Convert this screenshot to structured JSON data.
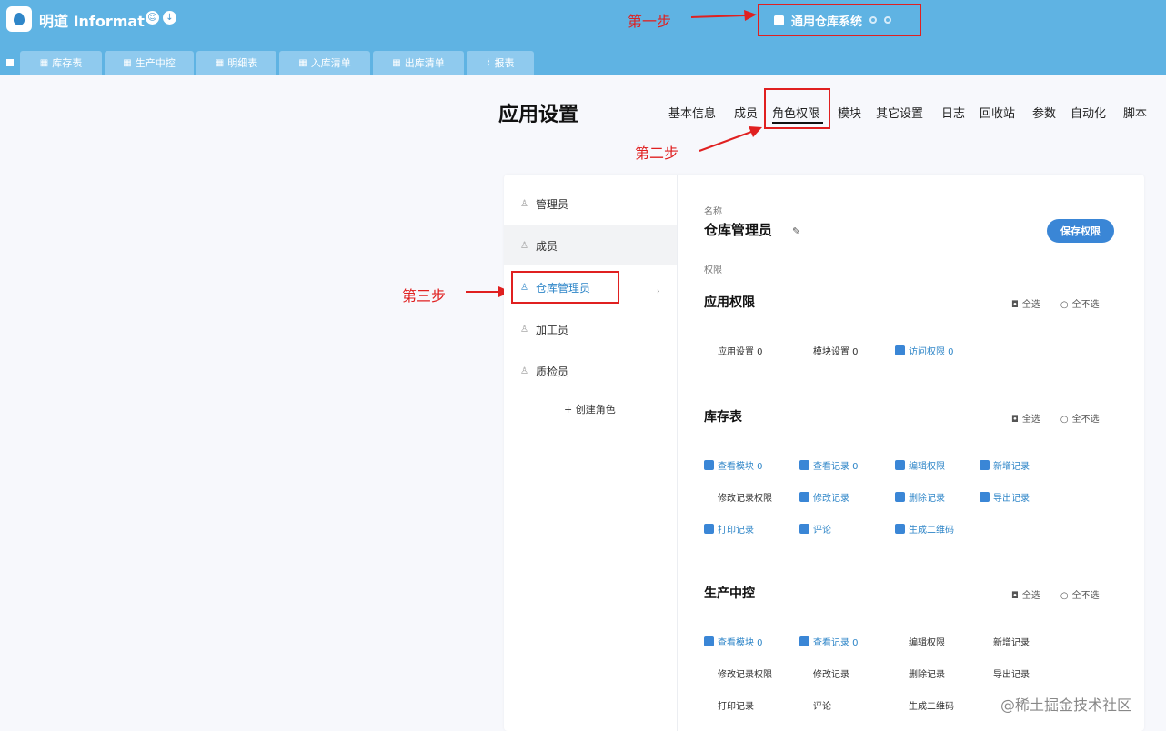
{
  "app": {
    "brand": "明道 Informat",
    "current_app": "通用仓库系统"
  },
  "tabs": [
    {
      "icon": "▦",
      "label": "库存表"
    },
    {
      "icon": "▦",
      "label": "生产中控"
    },
    {
      "icon": "▦",
      "label": "明细表"
    },
    {
      "icon": "▦",
      "label": "入库清单"
    },
    {
      "icon": "▦",
      "label": "出库清单"
    },
    {
      "icon": "⌇",
      "label": "报表"
    }
  ],
  "annotations": {
    "step1": "第一步",
    "step2": "第二步",
    "step3": "第三步"
  },
  "page_title": "应用设置",
  "settings_nav": [
    "基本信息",
    "成员",
    "角色权限",
    "模块",
    "其它设置",
    "日志",
    "回收站",
    "参数",
    "自动化",
    "脚本"
  ],
  "settings_nav_active": "角色权限",
  "roles": [
    {
      "icon": "♙",
      "label": "管理员"
    },
    {
      "icon": "♙",
      "label": "成员"
    },
    {
      "icon": "♙",
      "label": "仓库管理员"
    },
    {
      "icon": "♙",
      "label": "加工员"
    },
    {
      "icon": "♙",
      "label": "质检员"
    }
  ],
  "add_role_label": "+ 创建角色",
  "detail": {
    "name_label": "名称",
    "role_name": "仓库管理员",
    "permissions_label": "权限",
    "save_label": "保存权限",
    "select_all": "全选",
    "select_none": "全不选",
    "sections": [
      {
        "title": "应用权限",
        "rows": [
          [
            {
              "label": "应用设置 0",
              "checked": false
            },
            {
              "label": "模块设置 0",
              "checked": false
            },
            {
              "label": "访问权限 0",
              "checked": true
            }
          ]
        ]
      },
      {
        "title": "库存表",
        "rows": [
          [
            {
              "label": "查看模块 0",
              "checked": true
            },
            {
              "label": "查看记录 0",
              "checked": true
            },
            {
              "label": "编辑权限",
              "checked": true
            },
            {
              "label": "新增记录",
              "checked": true
            }
          ],
          [
            {
              "label": "修改记录权限",
              "checked": false
            },
            {
              "label": "修改记录",
              "checked": true
            },
            {
              "label": "删除记录",
              "checked": true
            },
            {
              "label": "导出记录",
              "checked": true
            }
          ],
          [
            {
              "label": "打印记录",
              "checked": true
            },
            {
              "label": "评论",
              "checked": true
            },
            {
              "label": "生成二维码",
              "checked": true
            }
          ]
        ]
      },
      {
        "title": "生产中控",
        "rows": [
          [
            {
              "label": "查看模块 0",
              "checked": true
            },
            {
              "label": "查看记录 0",
              "checked": true
            },
            {
              "label": "编辑权限",
              "checked": false
            },
            {
              "label": "新增记录",
              "checked": false
            }
          ],
          [
            {
              "label": "修改记录权限",
              "checked": false
            },
            {
              "label": "修改记录",
              "checked": false
            },
            {
              "label": "删除记录",
              "checked": false
            },
            {
              "label": "导出记录",
              "checked": false
            }
          ],
          [
            {
              "label": "打印记录",
              "checked": false
            },
            {
              "label": "评论",
              "checked": false
            },
            {
              "label": "生成二维码",
              "checked": false
            }
          ]
        ]
      }
    ]
  },
  "watermark": "@稀土掘金技术社区"
}
